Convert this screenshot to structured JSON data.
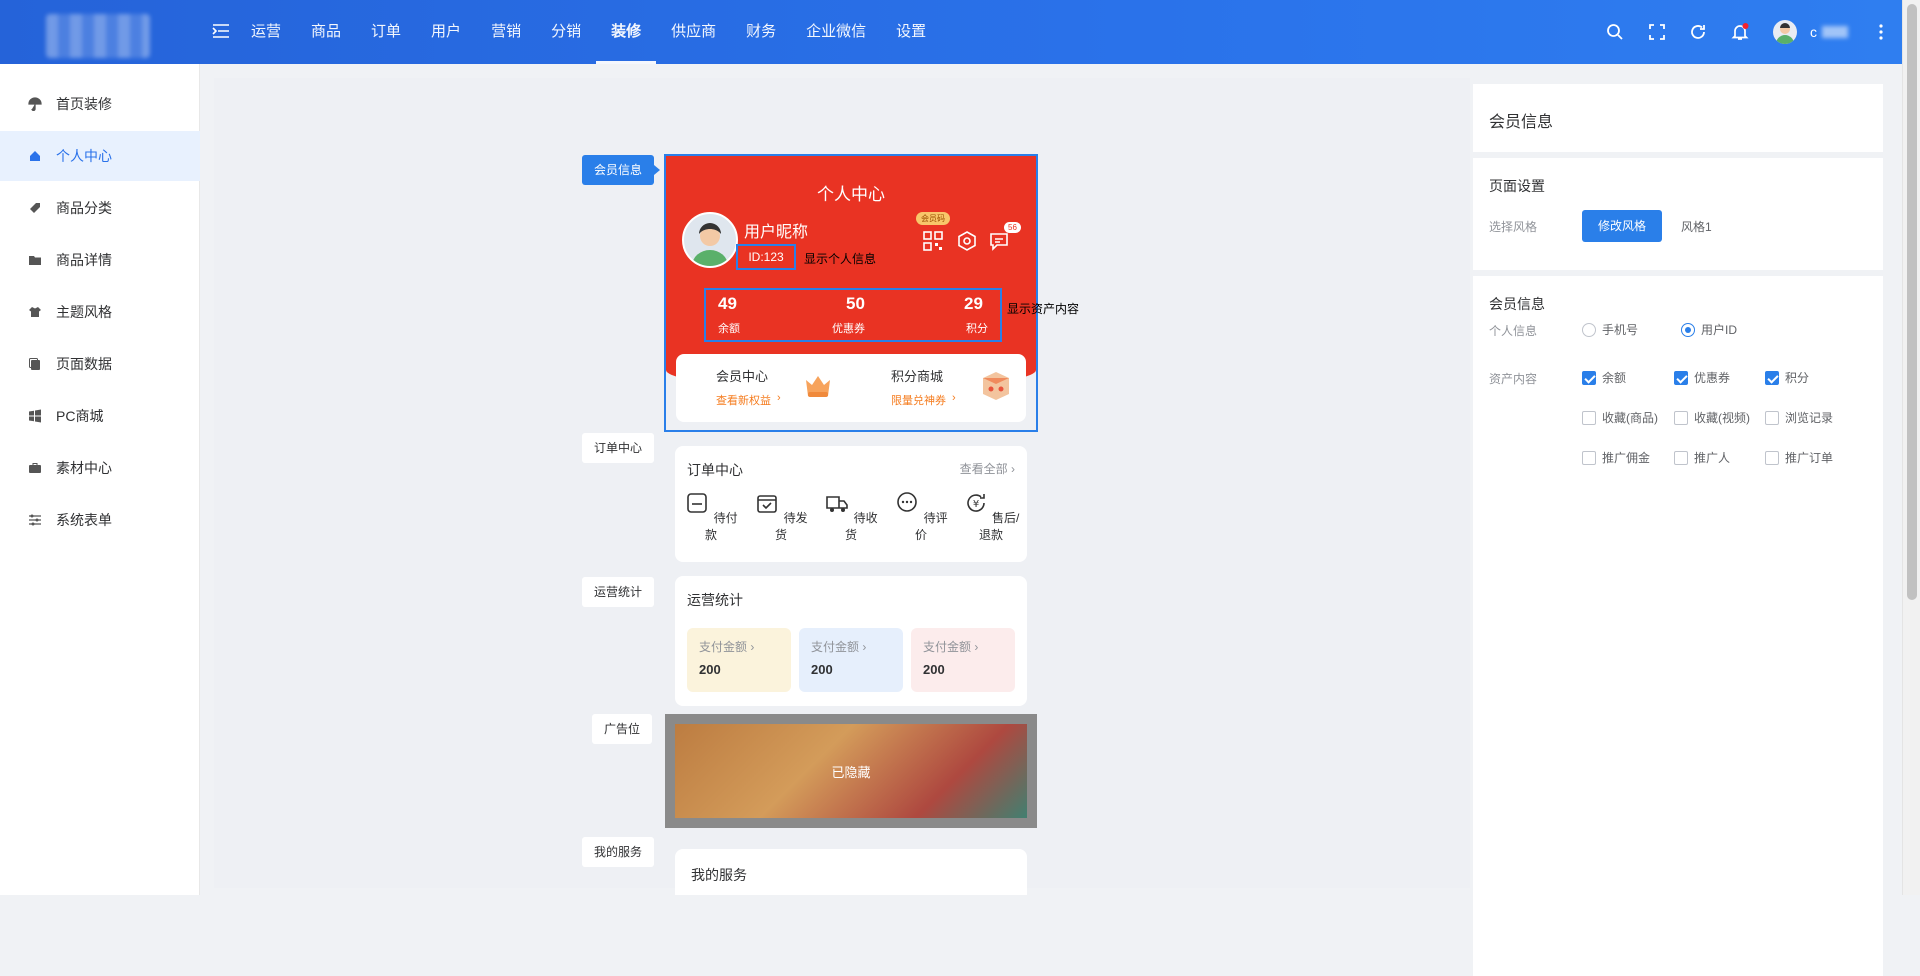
{
  "topnav": {
    "items": [
      {
        "label": "运营",
        "active": false
      },
      {
        "label": "商品",
        "active": false
      },
      {
        "label": "订单",
        "active": false
      },
      {
        "label": "用户",
        "active": false
      },
      {
        "label": "营销",
        "active": false
      },
      {
        "label": "分销",
        "active": false
      },
      {
        "label": "装修",
        "active": true
      },
      {
        "label": "供应商",
        "active": false
      },
      {
        "label": "财务",
        "active": false
      },
      {
        "label": "企业微信",
        "active": false
      },
      {
        "label": "设置",
        "active": false
      }
    ],
    "notification_dot": true,
    "user_name": "c"
  },
  "sidebar": {
    "items": [
      {
        "label": "首页装修",
        "icon": "umbrella-icon",
        "active": false
      },
      {
        "label": "个人中心",
        "icon": "home-icon",
        "active": true
      },
      {
        "label": "商品分类",
        "icon": "tag-icon",
        "active": false
      },
      {
        "label": "商品详情",
        "icon": "folder-icon",
        "active": false
      },
      {
        "label": "主题风格",
        "icon": "tshirt-icon",
        "active": false
      },
      {
        "label": "页面数据",
        "icon": "copy-icon",
        "active": false
      },
      {
        "label": "PC商城",
        "icon": "windows-icon",
        "active": false
      },
      {
        "label": "素材中心",
        "icon": "briefcase-icon",
        "active": false
      },
      {
        "label": "系统表单",
        "icon": "sliders-icon",
        "active": false
      }
    ]
  },
  "preview": {
    "tags": {
      "member": "会员信息",
      "order": "订单中心",
      "stats": "运营统计",
      "ad": "广告位",
      "service": "我的服务"
    },
    "member_card": {
      "title": "个人中心",
      "nickname": "用户昵称",
      "id_text": "ID:123",
      "show_info": "显示个人信息",
      "badge": "会员码",
      "msg_count": "56",
      "show_assets": "显示资产内容",
      "assets": [
        {
          "value": "49",
          "label": "余额"
        },
        {
          "value": "50",
          "label": "优惠券"
        },
        {
          "value": "29",
          "label": "积分"
        }
      ],
      "bottom": [
        {
          "title": "会员中心",
          "sub": "查看新权益"
        },
        {
          "title": "积分商城",
          "sub": "限量兑神券"
        }
      ]
    },
    "order_center": {
      "title": "订单中心",
      "more": "查看全部",
      "items": [
        {
          "label": "待付款",
          "icon": "wallet-icon"
        },
        {
          "label": "待发货",
          "icon": "box-icon"
        },
        {
          "label": "待收货",
          "icon": "truck-icon"
        },
        {
          "label": "待评价",
          "icon": "comment-icon"
        },
        {
          "label": "售后/退款",
          "icon": "refund-icon"
        }
      ]
    },
    "stats": {
      "title": "运营统计",
      "items": [
        {
          "label": "支付金额",
          "value": "200",
          "color": "#fbf3dc"
        },
        {
          "label": "支付金额",
          "value": "200",
          "color": "#e6effc"
        },
        {
          "label": "支付金额",
          "value": "200",
          "color": "#fcecec"
        }
      ]
    },
    "ad": {
      "hidden_text": "已隐藏"
    },
    "service": {
      "title": "我的服务"
    }
  },
  "right_panel": {
    "title": "会员信息",
    "page_settings": {
      "title": "页面设置",
      "style_label": "选择风格",
      "modify_button": "修改风格",
      "style_value": "风格1"
    },
    "member_info": {
      "title": "会员信息",
      "personal_label": "个人信息",
      "personal_options": [
        {
          "label": "手机号",
          "checked": false
        },
        {
          "label": "用户ID",
          "checked": true
        }
      ],
      "asset_label": "资产内容",
      "asset_options": [
        {
          "label": "余额",
          "checked": true
        },
        {
          "label": "优惠券",
          "checked": true
        },
        {
          "label": "积分",
          "checked": true
        },
        {
          "label": "收藏(商品)",
          "checked": false
        },
        {
          "label": "收藏(视频)",
          "checked": false
        },
        {
          "label": "浏览记录",
          "checked": false
        },
        {
          "label": "推广佣金",
          "checked": false
        },
        {
          "label": "推广人",
          "checked": false
        },
        {
          "label": "推广订单",
          "checked": false
        }
      ]
    }
  },
  "colors": {
    "primary": "#2a7fe9",
    "topbar": "#2a72ea",
    "member_red": "#e93323",
    "link_orange": "#f57c1f"
  }
}
